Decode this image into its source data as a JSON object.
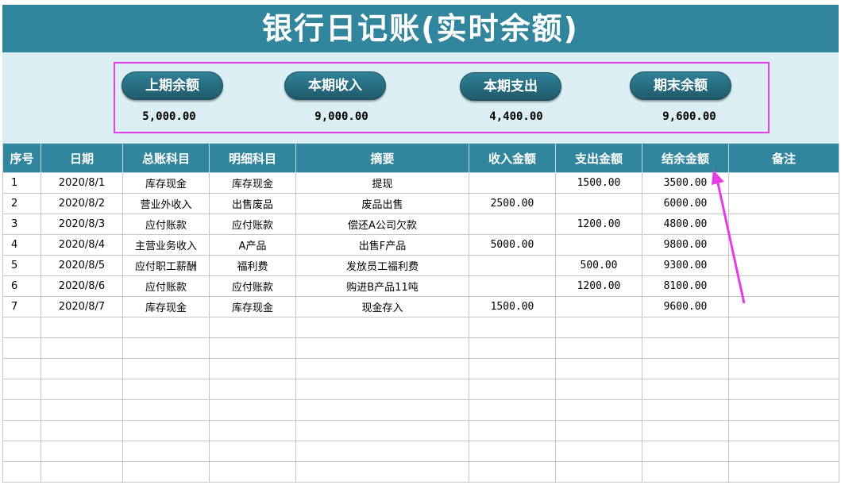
{
  "title": "银行日记账(实时余额)",
  "summary": {
    "items": [
      {
        "label": "上期余额",
        "value": "5,000.00"
      },
      {
        "label": "本期收入",
        "value": "9,000.00"
      },
      {
        "label": "本期支出",
        "value": "4,400.00"
      },
      {
        "label": "期末余额",
        "value": "9,600.00"
      }
    ]
  },
  "colors": {
    "header_bg": "#31859c",
    "summary_bg": "#daeef3",
    "highlight": "#e53de5"
  },
  "table": {
    "headers": [
      "序号",
      "日期",
      "总账科目",
      "明细科目",
      "摘要",
      "收入金额",
      "支出金额",
      "结余金额",
      "备注"
    ],
    "rows": [
      [
        "1",
        "2020/8/1",
        "库存现金",
        "库存现金",
        "提现",
        "",
        "1500.00",
        "3500.00",
        ""
      ],
      [
        "2",
        "2020/8/2",
        "营业外收入",
        "出售废品",
        "废品出售",
        "2500.00",
        "",
        "6000.00",
        ""
      ],
      [
        "3",
        "2020/8/3",
        "应付账款",
        "应付账款",
        "偿还A公司欠款",
        "",
        "1200.00",
        "4800.00",
        ""
      ],
      [
        "4",
        "2020/8/4",
        "主营业务收入",
        "A产品",
        "出售F产品",
        "5000.00",
        "",
        "9800.00",
        ""
      ],
      [
        "5",
        "2020/8/5",
        "应付职工薪酬",
        "福利费",
        "发放员工福利费",
        "",
        "500.00",
        "9300.00",
        ""
      ],
      [
        "6",
        "2020/8/6",
        "应付账款",
        "应付账款",
        "购进B产品11吨",
        "",
        "1200.00",
        "8100.00",
        ""
      ],
      [
        "7",
        "2020/8/7",
        "库存现金",
        "库存现金",
        "现金存入",
        "1500.00",
        "",
        "9600.00",
        ""
      ]
    ],
    "empty_rows": 8
  }
}
